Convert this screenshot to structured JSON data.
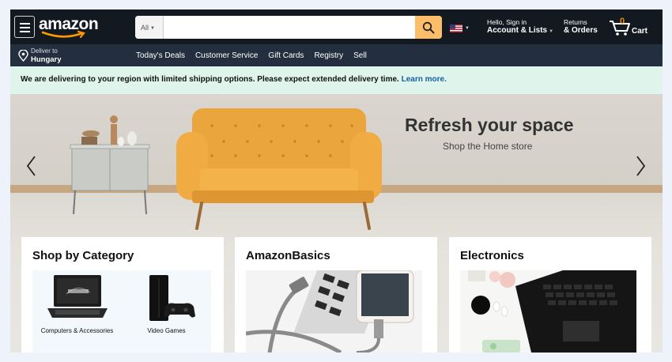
{
  "nav": {
    "logo": "amazon",
    "search_category": "All",
    "search_placeholder": "",
    "account_line1": "Hello, Sign in",
    "account_line2": "Account & Lists",
    "orders_line1": "Returns",
    "orders_line2": "& Orders",
    "cart_count": "0",
    "cart_label": "Cart"
  },
  "subnav": {
    "deliver_line1": "Deliver to",
    "deliver_line2": "Hungary",
    "links": [
      "Today's Deals",
      "Customer Service",
      "Gift Cards",
      "Registry",
      "Sell"
    ]
  },
  "notice": {
    "text": "We are delivering to your region with limited shipping options. Please expect extended delivery time.",
    "link": "Learn more."
  },
  "hero": {
    "title": "Refresh your space",
    "subtitle": "Shop the Home store"
  },
  "cards": [
    {
      "title": "Shop by Category",
      "tiles": [
        {
          "label": "Computers & Accessories",
          "icon": "laptop-icon"
        },
        {
          "label": "Video Games",
          "icon": "game-console-icon"
        }
      ]
    },
    {
      "title": "AmazonBasics"
    },
    {
      "title": "Electronics"
    }
  ],
  "colors": {
    "nav_bg": "#131921",
    "subnav_bg": "#232f3e",
    "search_button": "#febd69",
    "cart_count": "#f08804",
    "notice_bg": "#dff5ec",
    "link": "#1560a8"
  }
}
